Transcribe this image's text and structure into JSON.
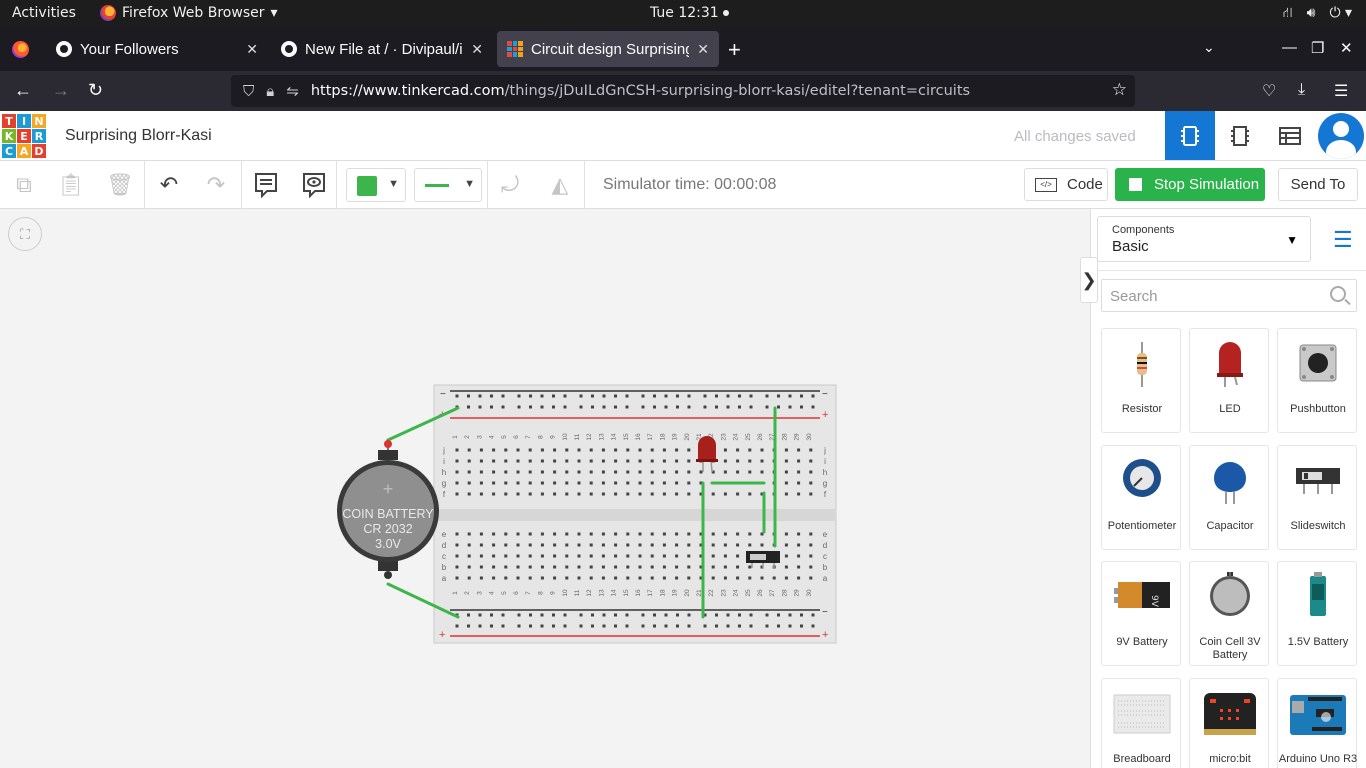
{
  "os": {
    "activities": "Activities",
    "app_name": "Firefox Web Browser",
    "clock": "Tue 12:31"
  },
  "browser": {
    "tabs": [
      {
        "title": "Your Followers",
        "active": false
      },
      {
        "title": "New File at / · Divipaul/in",
        "active": false
      },
      {
        "title": "Circuit design Surprising B",
        "active": true
      }
    ],
    "url_host": "https://www.tinkercad.com",
    "url_path": "/things/jDuILdGnCSH-surprising-blorr-kasi/editel?tenant=circuits"
  },
  "app": {
    "logo_letters": [
      "T",
      "I",
      "N",
      "K",
      "E",
      "R",
      "C",
      "A",
      "D"
    ],
    "project_name": "Surprising Blorr-Kasi",
    "save_status": "All changes saved",
    "simulator_time": "Simulator time: 00:00:08",
    "code_label": "Code",
    "stop_label": "Stop Simulation",
    "send_label": "Send To",
    "wire_color": "#3cb64a",
    "accent": "#1477d4"
  },
  "panel": {
    "components_label": "Components",
    "components_value": "Basic",
    "search_placeholder": "Search",
    "items": [
      {
        "name": "Resistor",
        "icon": "resistor-icon"
      },
      {
        "name": "LED",
        "icon": "led-icon"
      },
      {
        "name": "Pushbutton",
        "icon": "pushbutton-icon"
      },
      {
        "name": "Potentiometer",
        "icon": "potentiometer-icon"
      },
      {
        "name": "Capacitor",
        "icon": "capacitor-icon"
      },
      {
        "name": "Slideswitch",
        "icon": "slideswitch-icon"
      },
      {
        "name": "9V Battery",
        "icon": "battery-9v-icon"
      },
      {
        "name": "Coin Cell 3V Battery",
        "icon": "coin-cell-icon"
      },
      {
        "name": "1.5V Battery",
        "icon": "battery-aa-icon"
      },
      {
        "name": "Breadboard",
        "icon": "breadboard-icon"
      },
      {
        "name": "micro:bit",
        "icon": "microbit-icon"
      },
      {
        "name": "Arduino Uno R3",
        "icon": "arduino-icon"
      }
    ]
  },
  "circuit": {
    "battery_lines": [
      "COIN BATTERY",
      "CR 2032",
      "3.0V"
    ],
    "battery_plus": "+",
    "rail_minus": "−",
    "rail_plus": "+",
    "row_letters_top": [
      "j",
      "i",
      "h",
      "g",
      "f"
    ],
    "row_letters_bottom": [
      "e",
      "d",
      "c",
      "b",
      "a"
    ],
    "column_numbers": [
      "1",
      "2",
      "3",
      "4",
      "5",
      "6",
      "7",
      "8",
      "9",
      "10",
      "11",
      "12",
      "13",
      "14",
      "15",
      "16",
      "17",
      "18",
      "19",
      "20",
      "21",
      "22",
      "23",
      "24",
      "25",
      "26",
      "27",
      "28",
      "29",
      "30"
    ]
  }
}
